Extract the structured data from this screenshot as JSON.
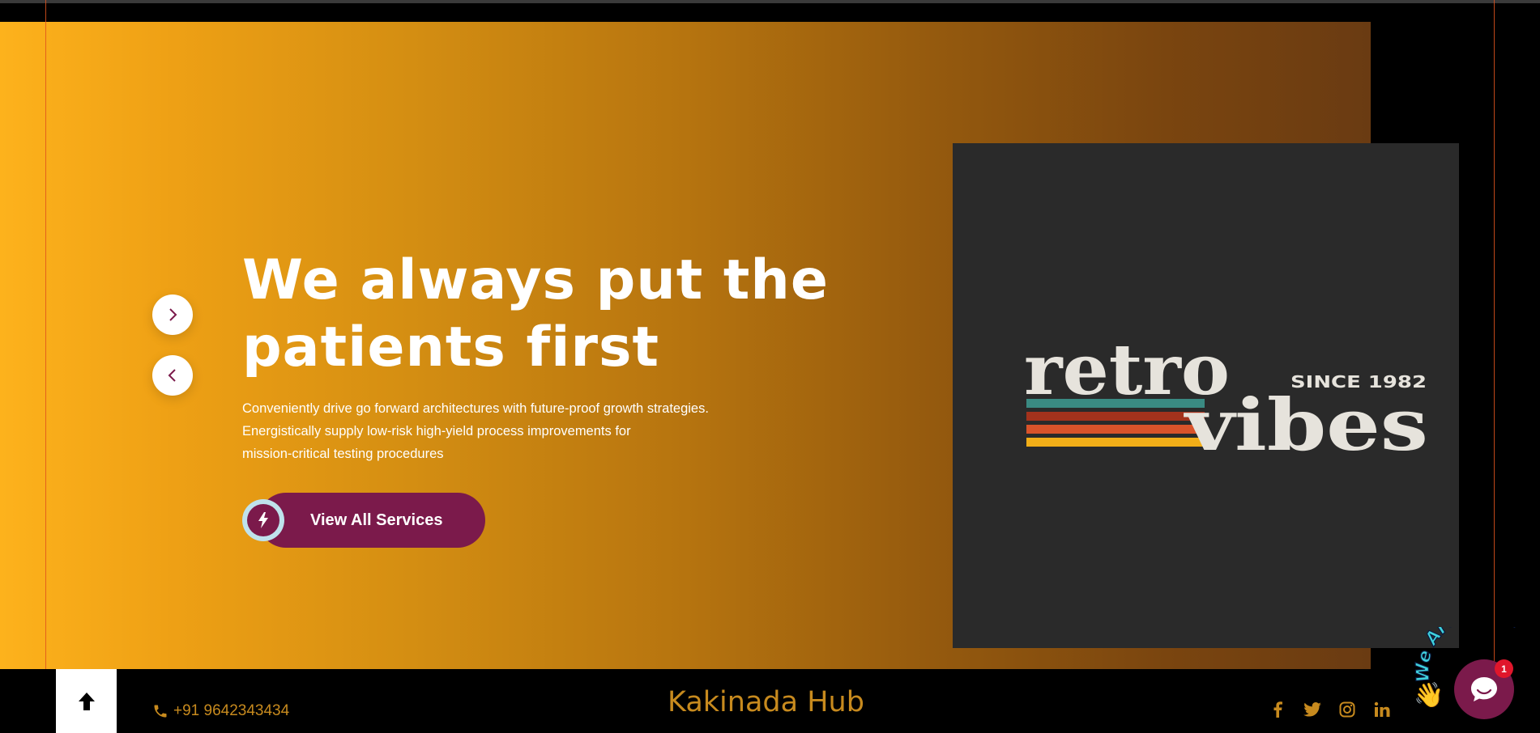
{
  "hero": {
    "headline": "We always put the patients first",
    "description_lines": [
      "Conveniently drive go forward architectures with future-proof growth strategies.",
      "Energistically supply low-risk high-yield process improvements for",
      "mission-critical testing procedures"
    ],
    "cta_label": "View All Services",
    "cta_icon": "lightning-bolt-icon",
    "next_icon": "chevron-right-icon",
    "prev_icon": "chevron-left-icon"
  },
  "logo": {
    "word_1": "retro",
    "word_2": "vibes",
    "tagline": "SINCE 1982",
    "stripe_colors": [
      "#3a8a82",
      "#a3321c",
      "#d9532a",
      "#f2ae18"
    ],
    "text_color": "#e6e3dc",
    "background": "#2a2a2a"
  },
  "footer": {
    "phone": "+91 9642343434",
    "phone_icon": "phone-icon",
    "brand": "Kakinada Hub",
    "back_to_top_icon": "arrow-up-icon",
    "social_icons": [
      "facebook-icon",
      "twitter-icon",
      "instagram-icon",
      "linkedin-icon"
    ]
  },
  "chat_widget": {
    "label": "We Are Here!",
    "badge_count": "1",
    "wave_emoji": "👋",
    "icon": "chat-bubble-icon"
  },
  "colors": {
    "accent_primary": "#7b1a4b",
    "accent_gold": "#c78a1e",
    "hero_gradient_start": "#fdb21c",
    "hero_gradient_end": "#6a3b12",
    "guide_line": "#e0541d"
  }
}
